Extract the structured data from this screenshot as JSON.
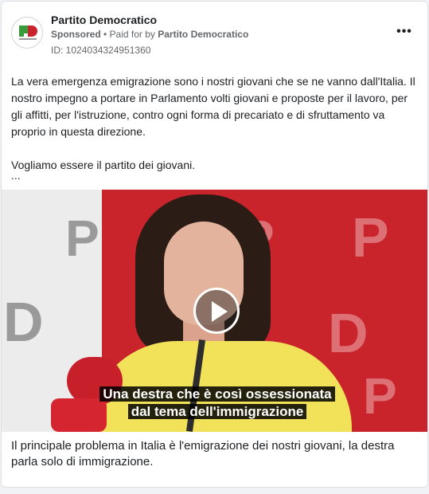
{
  "ad": {
    "page_name": "Partito Democratico",
    "sponsored_label": "Sponsored",
    "separator": " • ",
    "paid_for_prefix": "Paid for by ",
    "paid_for_by": "Partito Democratico",
    "id_label": "ID: 1024034324951360",
    "more_icon_glyph": "•••",
    "avatar_label": "Partito Democratico",
    "avatar_letters": "PD"
  },
  "body": {
    "paragraph_1": "La vera emergenza emigrazione sono i nostri giovani che se ne vanno dall'Italia. Il nostro impegno a portare in Parlamento volti giovani e proposte per il lavoro, per gli affitti, per l'istruzione, contro ogni forma di precariato e di sfruttamento va proprio in questa direzione.",
    "paragraph_2": "Vogliamo essere il partito dei giovani.",
    "ellipsis": "..."
  },
  "media": {
    "subtitle_line_1": "Una destra che è così ossessionata",
    "subtitle_line_2": "dal tema dell'immigrazione",
    "play_icon": "play-icon"
  },
  "caption": {
    "text": "Il principale problema in Italia è l'emigrazione dei nostri giovani, la destra parla solo di immigrazione."
  },
  "colors": {
    "brand_red": "#c9242c",
    "brand_green": "#3a9b3a",
    "text_primary": "#1c1e21",
    "text_secondary": "#65676b"
  }
}
